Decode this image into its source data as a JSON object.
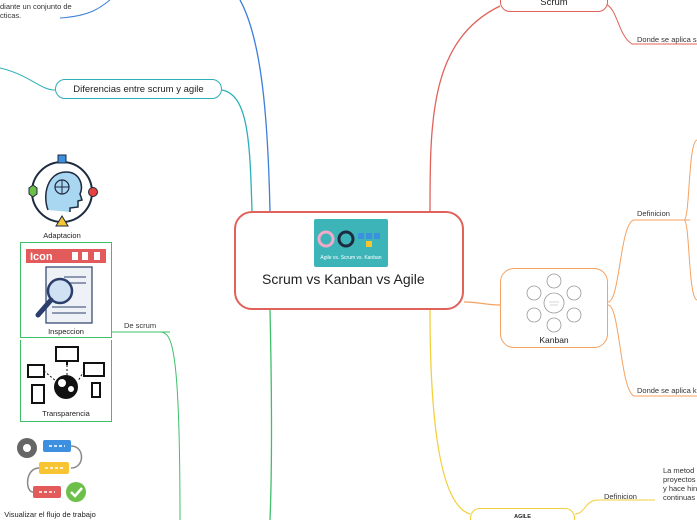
{
  "central": {
    "title": "Scrum vs Kanban vs Agile",
    "thumbnail_text": "Agile vs. Scrum vs. Kanban"
  },
  "left": {
    "top_note": "diante un conjunto de\ncticas.",
    "differences_label": "Diferencias entre scrum y agile",
    "scrum_branch_label": "De scrum",
    "cards": [
      {
        "caption": "Adaptacion",
        "icon": "head-gears-icon"
      },
      {
        "caption": "Inspeccion",
        "icon": "magnifier-document-icon",
        "header_text": "Icon"
      },
      {
        "caption": "Transparencia",
        "icon": "devices-network-icon"
      },
      {
        "caption": "Visualizar el flujo de trabajo",
        "icon": "workflow-icon"
      }
    ]
  },
  "right": {
    "scrum_label": "Scrum",
    "scrum_where": "Donde se aplica s",
    "kanban_label": "Kanban",
    "kanban_definition": "Definicion",
    "kanban_where": "Donde se aplica k",
    "agile_label": "AGILE",
    "agile_definition": "Definicion",
    "agile_text_lines": [
      "La metod",
      "proyectos",
      "y hace hin",
      "continuas"
    ]
  },
  "colors": {
    "central_border": "#e0625a",
    "branch_red": "#e0625a",
    "branch_orange": "#f4a261",
    "branch_yellow": "#f2cf3b",
    "branch_teal": "#2ab0b8",
    "branch_green": "#3fbf6a",
    "branch_blue": "#3d7fd9"
  }
}
